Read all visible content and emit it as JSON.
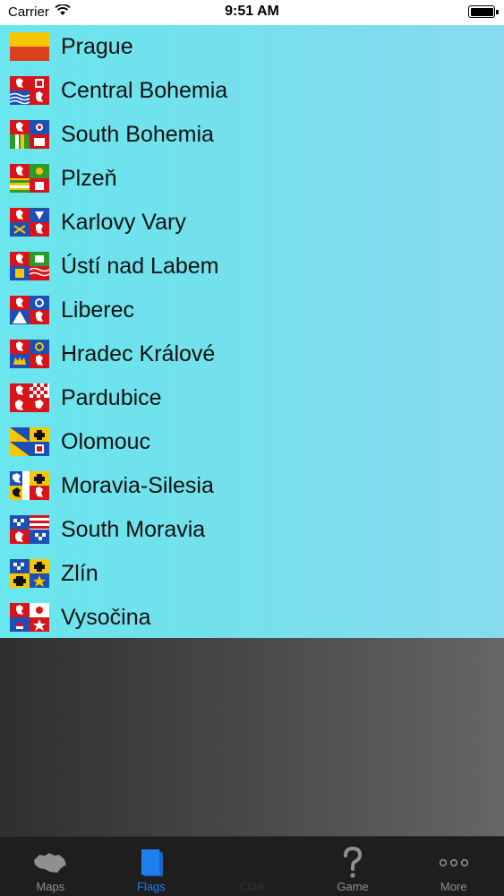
{
  "status_bar": {
    "carrier": "Carrier",
    "time": "9:51 AM",
    "battery_level": 1.0
  },
  "regions": [
    {
      "name": "Prague",
      "flag": "prague-flag"
    },
    {
      "name": "Central Bohemia",
      "flag": "central-bohemia-flag"
    },
    {
      "name": "South Bohemia",
      "flag": "south-bohemia-flag"
    },
    {
      "name": "Plzeň",
      "flag": "plzen-flag"
    },
    {
      "name": "Karlovy Vary",
      "flag": "karlovy-vary-flag"
    },
    {
      "name": "Ústí nad Labem",
      "flag": "usti-nad-labem-flag"
    },
    {
      "name": "Liberec",
      "flag": "liberec-flag"
    },
    {
      "name": "Hradec Králové",
      "flag": "hradec-kralove-flag"
    },
    {
      "name": "Pardubice",
      "flag": "pardubice-flag"
    },
    {
      "name": "Olomouc",
      "flag": "olomouc-flag"
    },
    {
      "name": "Moravia-Silesia",
      "flag": "moravia-silesia-flag"
    },
    {
      "name": "South Moravia",
      "flag": "south-moravia-flag"
    },
    {
      "name": "Zlín",
      "flag": "zlin-flag"
    },
    {
      "name": "Vysočina",
      "flag": "vysocina-flag"
    }
  ],
  "tab_bar": {
    "tabs": [
      {
        "label": "Maps",
        "icon": "czech-map-icon",
        "state": "normal"
      },
      {
        "label": "Flags",
        "icon": "flag-icon",
        "state": "active"
      },
      {
        "label": "COA",
        "icon": "coat-of-arms-icon",
        "state": "dim"
      },
      {
        "label": "Game",
        "icon": "question-mark-icon",
        "state": "normal"
      },
      {
        "label": "More",
        "icon": "more-dots-icon",
        "state": "normal"
      }
    ]
  },
  "colors": {
    "list_bg_left": "#69e6ee",
    "list_bg_right": "#88dbef",
    "active_tab": "#1f7ff0",
    "tab_bar_bg": "#1e1e1e"
  }
}
